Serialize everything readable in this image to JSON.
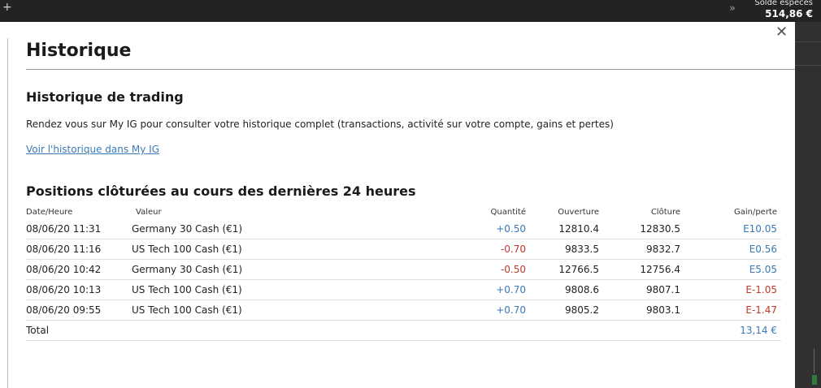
{
  "topbar": {
    "plus_glyph": "+",
    "chevron_glyph": "»",
    "balance_label": "Solde espèces",
    "balance_value": "514,86 €"
  },
  "modal": {
    "close_glyph": "✕",
    "title": "Historique",
    "trading_section": {
      "heading": "Historique de trading",
      "description": "Rendez vous sur My IG pour consulter votre historique complet (transactions, activité sur votre compte, gains et pertes)",
      "link_text": "Voir l'historique dans My IG"
    },
    "positions_section": {
      "heading": "Positions clôturées au cours des dernières 24 heures",
      "columns": {
        "date": "Date/Heure",
        "value": "Valeur",
        "quantity": "Quantité",
        "open": "Ouverture",
        "close": "Clôture",
        "gain": "Gain/perte"
      },
      "rows": [
        {
          "date": "08/06/20 11:31",
          "value": "Germany 30 Cash (€1)",
          "quantity": "+0.50",
          "open": "12810.4",
          "close": "12830.5",
          "gain": "E10.05"
        },
        {
          "date": "08/06/20 11:16",
          "value": "US Tech 100 Cash (€1)",
          "quantity": "-0.70",
          "open": "9833.5",
          "close": "9832.7",
          "gain": "E0.56"
        },
        {
          "date": "08/06/20 10:42",
          "value": "Germany 30 Cash (€1)",
          "quantity": "-0.50",
          "open": "12766.5",
          "close": "12756.4",
          "gain": "E5.05"
        },
        {
          "date": "08/06/20 10:13",
          "value": "US Tech 100 Cash (€1)",
          "quantity": "+0.70",
          "open": "9808.6",
          "close": "9807.1",
          "gain": "E-1.05"
        },
        {
          "date": "08/06/20 09:55",
          "value": "US Tech 100 Cash (€1)",
          "quantity": "+0.70",
          "open": "9805.2",
          "close": "9803.1",
          "gain": "E-1.47"
        }
      ],
      "total_label": "Total",
      "total_value": "13,14 €"
    }
  },
  "colors": {
    "positive": "#3a7ab8",
    "negative": "#c0392b",
    "topbar": "#232323"
  }
}
